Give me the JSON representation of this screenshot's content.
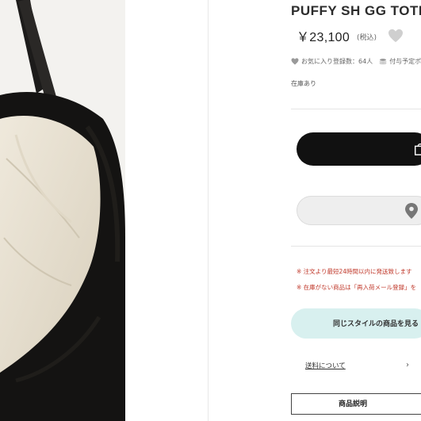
{
  "product": {
    "title": "PUFFY SH GG TOTE",
    "price": "￥23,100",
    "tax_note": "(税込)"
  },
  "meta": {
    "favorites": "お気に入り登録数：64人",
    "points": "付与予定ポイント"
  },
  "stock_status": "在庫あり",
  "notices": [
    "※ 注文より最短24時間以内に発送致します",
    "※ 在庫がない商品は「再入荷メール登録」を"
  ],
  "buttons": {
    "similar_style": "同じスタイルの商品を見る",
    "shipping": "送料について",
    "description": "商品説明"
  },
  "colors": {
    "cart_button": "#111111",
    "similar_button": "#d8f0ef",
    "notice_text": "#c0392b"
  }
}
